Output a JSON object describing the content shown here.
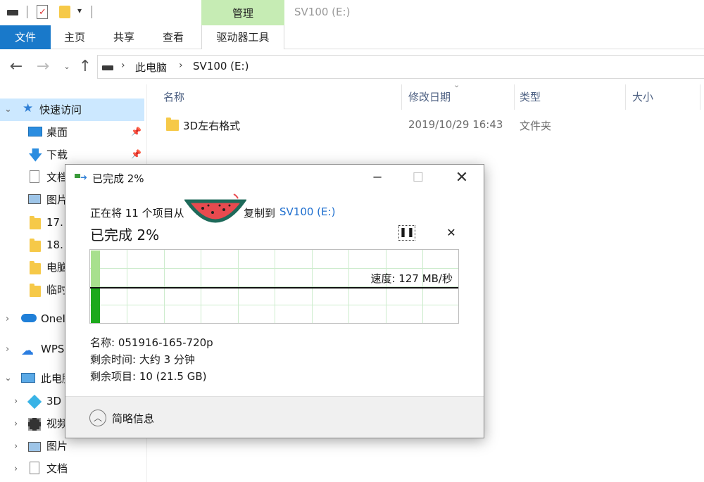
{
  "window": {
    "title": "SV100 (E:)",
    "context_tab": "管理"
  },
  "ribbon": {
    "tabs": [
      "文件",
      "主页",
      "共享",
      "查看",
      "驱动器工具"
    ]
  },
  "address": {
    "crumbs": [
      "此电脑",
      "SV100 (E:)"
    ]
  },
  "columns": {
    "name": "名称",
    "modified": "修改日期",
    "type": "类型",
    "size": "大小"
  },
  "files": [
    {
      "name": "3D左右格式",
      "modified": "2019/10/29 16:43",
      "type": "文件夹",
      "size": ""
    }
  ],
  "sidebar": {
    "quick_access": "快速访问",
    "quick_items": [
      "桌面",
      "下载",
      "文档",
      "图片",
      "17.",
      "18.",
      "电脑",
      "临时"
    ],
    "onedrive": "OneI",
    "wps": "WPS",
    "this_pc": "此电脑",
    "pc_items": [
      "3D",
      "视频",
      "图片",
      "文档"
    ]
  },
  "dialog": {
    "title": "已完成 2%",
    "status_prefix": "正在将 11 个项目从",
    "status_mid": "复制到",
    "destination": "SV100 (E:)",
    "percent_label": "已完成 2%",
    "percent": 2,
    "speed": "速度: 127 MB/秒",
    "name_line": "名称: 051916-165-720p",
    "time_line": "剩余时间: 大约 3 分钟",
    "items_line": "剩余项目: 10 (21.5 GB)",
    "details_label": "简略信息"
  }
}
